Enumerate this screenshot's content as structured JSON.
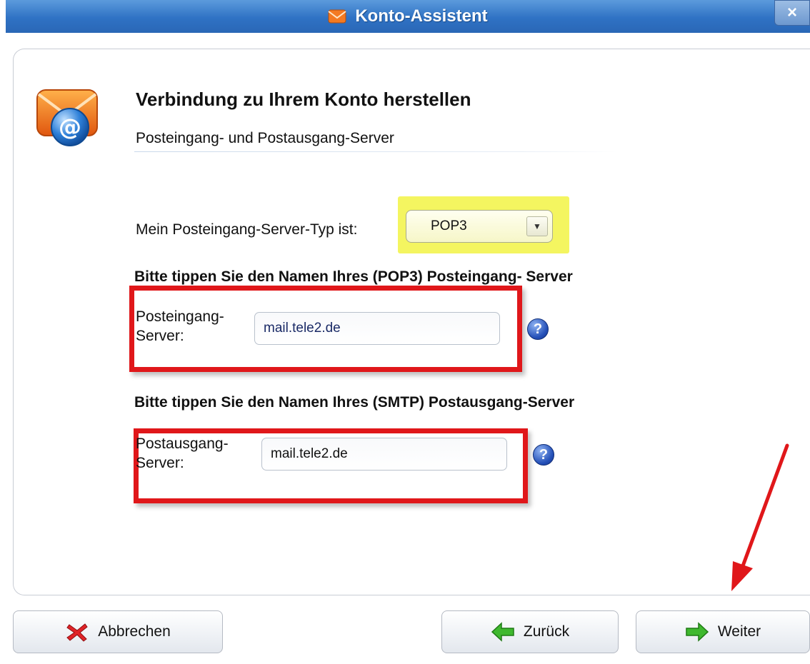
{
  "window": {
    "title": "Konto-Assistent",
    "close_symbol": "×"
  },
  "header": {
    "title": "Verbindung zu Ihrem Konto herstellen",
    "subtitle": "Posteingang- und Postausgang-Server",
    "icon": "mail-at-icon"
  },
  "server_type": {
    "label": "Mein Posteingang-Server-Typ ist:",
    "selected": "POP3",
    "highlight_color": "#f4f560"
  },
  "incoming": {
    "section_title": "Bitte tippen Sie den Namen Ihres (POP3) Posteingang- Server",
    "label_line1": "Posteingang-",
    "label_line2": "Server:",
    "value": "mail.tele2.de",
    "help_icon": "?"
  },
  "outgoing": {
    "section_title": "Bitte tippen Sie den Namen Ihres (SMTP) Postausgang-Server",
    "label_line1": "Postausgang-",
    "label_line2": "Server:",
    "value": "mail.tele2.de",
    "help_icon": "?"
  },
  "buttons": {
    "cancel": "Abbrechen",
    "back": "Zurück",
    "next": "Weiter"
  },
  "colors": {
    "annotation_red": "#e0171a",
    "titlebar_blue": "#2f72c4",
    "arrow_green": "#3fb82e"
  }
}
